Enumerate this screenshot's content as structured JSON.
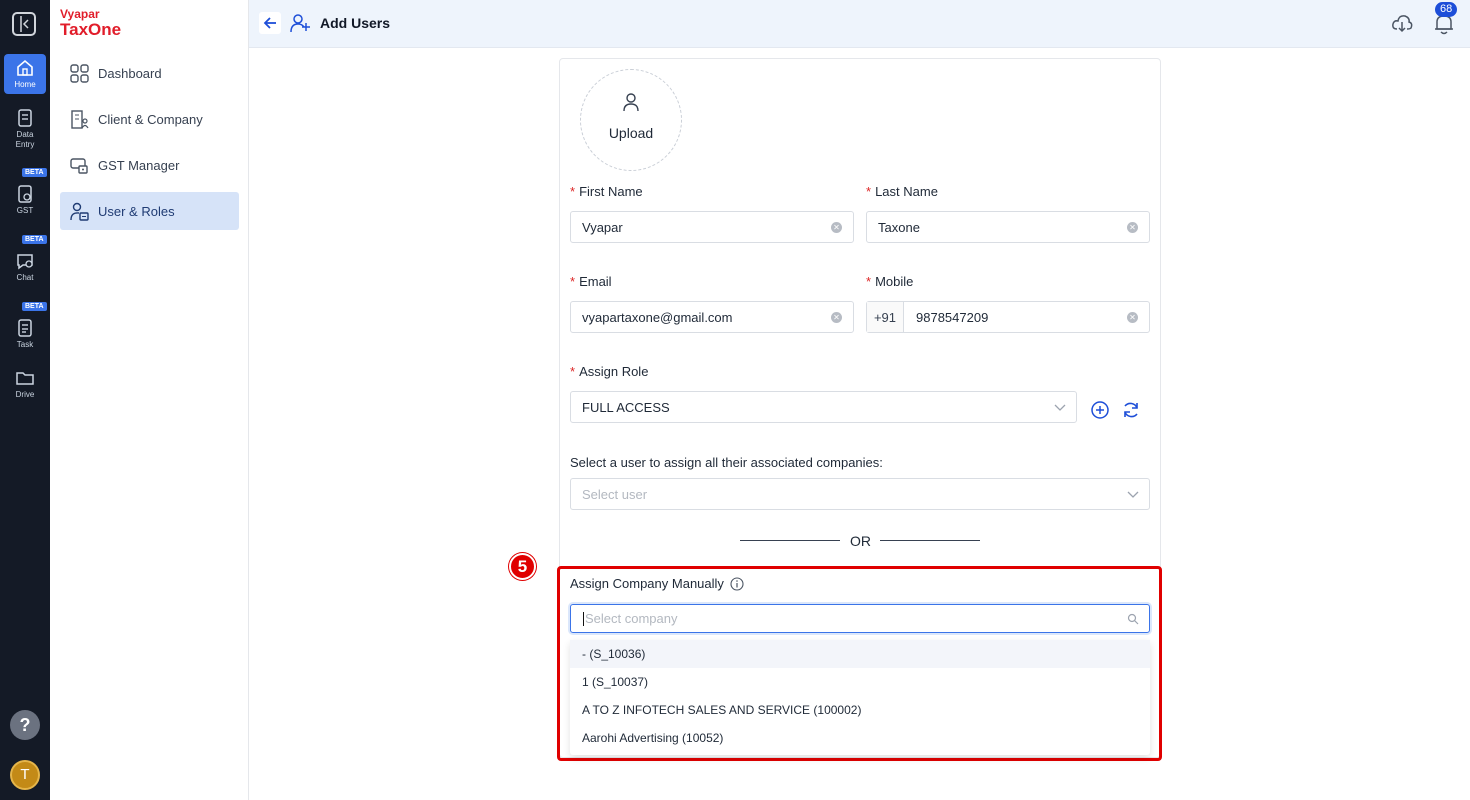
{
  "rail": {
    "items": [
      {
        "label": "Home",
        "icon": "home-icon",
        "active": true
      },
      {
        "label": "Data Entry",
        "icon": "data-entry-icon"
      },
      {
        "label": "GST",
        "icon": "gst-icon",
        "badge": "BETA"
      },
      {
        "label": "Chat",
        "icon": "chat-icon",
        "badge": "BETA"
      },
      {
        "label": "Task",
        "icon": "task-icon",
        "badge": "BETA"
      },
      {
        "label": "Drive",
        "icon": "folder-icon"
      }
    ],
    "help": "?",
    "avatar": "T"
  },
  "brand": {
    "top": "Vyapar",
    "bottom": "TaxOne"
  },
  "sidebar": {
    "items": [
      {
        "label": "Dashboard",
        "icon": "dashboard-icon"
      },
      {
        "label": "Client & Company",
        "icon": "building-icon"
      },
      {
        "label": "GST Manager",
        "icon": "gst-manager-icon"
      },
      {
        "label": "User & Roles",
        "icon": "user-roles-icon",
        "active": true
      }
    ]
  },
  "header": {
    "title": "Add Users",
    "notification_count": "68"
  },
  "form": {
    "upload_label": "Upload",
    "first_name": {
      "label": "First Name",
      "value": "Vyapar"
    },
    "last_name": {
      "label": "Last Name",
      "value": "Taxone"
    },
    "email": {
      "label": "Email",
      "value": "vyapartaxone@gmail.com"
    },
    "mobile": {
      "label": "Mobile",
      "prefix": "+91",
      "value": "9878547209"
    },
    "assign_role": {
      "label": "Assign Role",
      "value": "FULL ACCESS"
    },
    "select_user": {
      "label": "Select a user to assign all their associated companies:",
      "placeholder": "Select user"
    },
    "or_text": "OR",
    "assign_company": {
      "label": "Assign Company Manually",
      "placeholder": "Select company",
      "options": [
        "- (S_10036)",
        "1 (S_10037)",
        "A TO Z INFOTECH SALES AND SERVICE (100002)",
        "Aarohi Advertising (10052)"
      ]
    }
  },
  "annotation": {
    "step": "5"
  },
  "colors": {
    "accent": "#3b74e8",
    "brand": "#e11d2a",
    "highlight": "#e00000"
  }
}
